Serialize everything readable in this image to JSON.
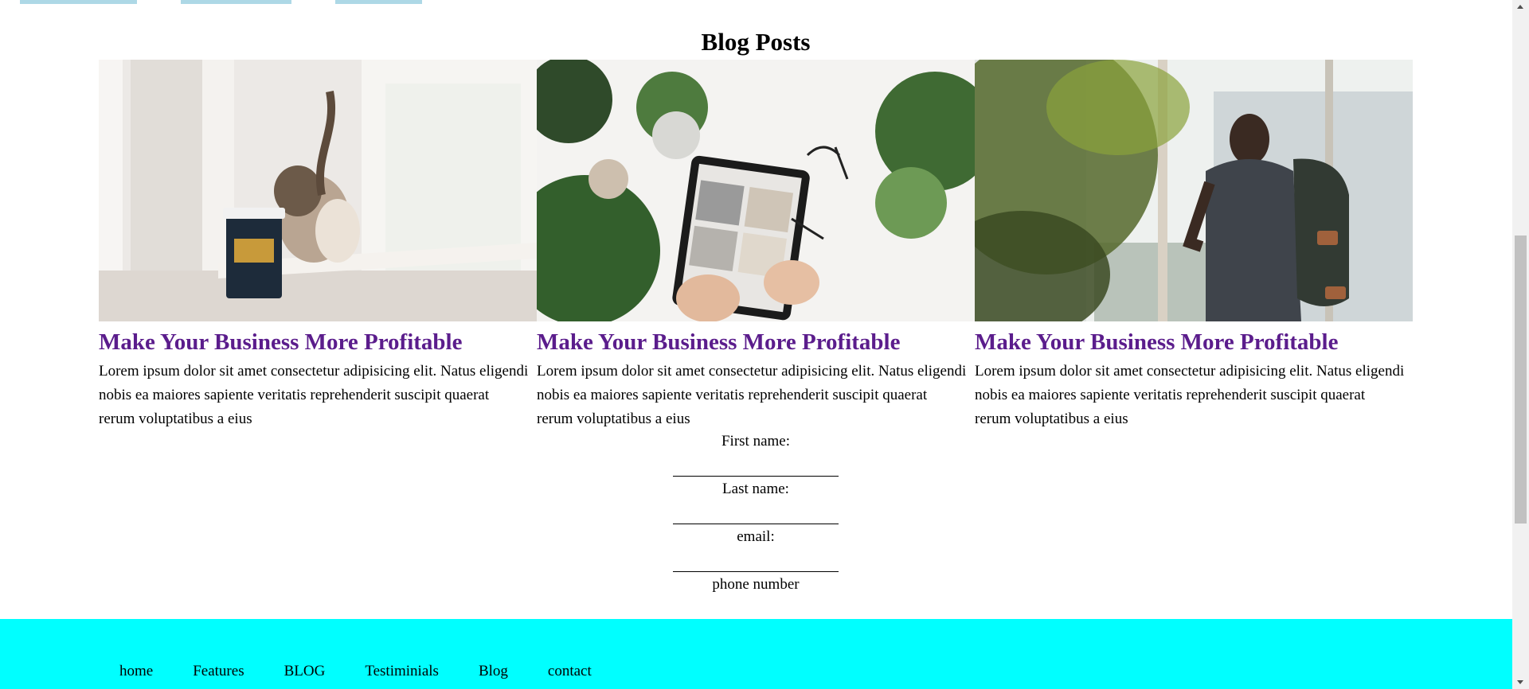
{
  "colors": {
    "accent_tab": "#add8e6",
    "post_title": "#5b1d8c",
    "footer_bg": "#00ffff"
  },
  "section": {
    "title": "Blog Posts"
  },
  "posts": [
    {
      "image": "cat-with-coffee-cup-photo",
      "title": "Make Your Business More Profitable",
      "body": "Lorem ipsum dolor sit amet consectetur adipisicing elit. Natus eligendi nobis ea maiores sapiente veritatis reprehenderit suscipit quaerat rerum voluptatibus a eius"
    },
    {
      "image": "tablet-and-plants-photo",
      "title": "Make Your Business More Profitable",
      "body": "Lorem ipsum dolor sit amet consectetur adipisicing elit. Natus eligendi nobis ea maiores sapiente veritatis reprehenderit suscipit quaerat rerum voluptatibus a eius"
    },
    {
      "image": "man-with-backpack-photo",
      "title": "Make Your Business More Profitable",
      "body": "Lorem ipsum dolor sit amet consectetur adipisicing elit. Natus eligendi nobis ea maiores sapiente veritatis reprehenderit suscipit quaerat rerum voluptatibus a eius"
    }
  ],
  "form": {
    "first_name": {
      "label": "First name:",
      "value": ""
    },
    "last_name": {
      "label": "Last name:",
      "value": ""
    },
    "email": {
      "label": "email:",
      "value": ""
    },
    "phone": {
      "label": "phone number",
      "value": ""
    }
  },
  "footer": {
    "links": [
      "home",
      "Features",
      "BLOG",
      "Testiminials",
      "Blog",
      "contact"
    ]
  }
}
